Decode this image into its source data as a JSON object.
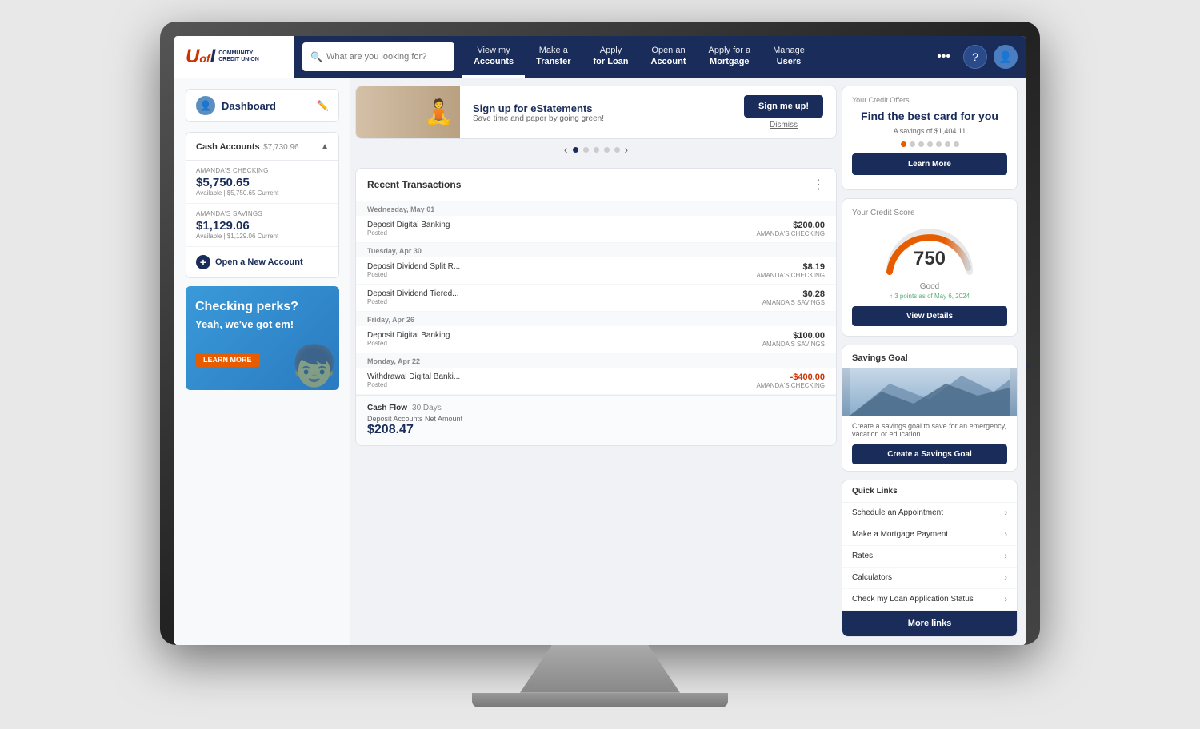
{
  "app": {
    "title": "U of I Community Credit Union",
    "logo_main": "UofI",
    "logo_sub_line1": "COMMUNITY",
    "logo_sub_line2": "CREDIT UNION"
  },
  "search": {
    "placeholder": "What are you looking for?"
  },
  "nav": {
    "items": [
      {
        "line1": "View my",
        "line2": "Accounts",
        "active": true
      },
      {
        "line1": "Make a",
        "line2": "Transfer",
        "active": false
      },
      {
        "line1": "Apply",
        "line2": "for Loan",
        "active": false
      },
      {
        "line1": "Open an",
        "line2": "Account",
        "active": false
      },
      {
        "line1": "Apply for a",
        "line2": "Mortgage",
        "active": false
      },
      {
        "line1": "Manage",
        "line2": "Users",
        "active": false
      }
    ],
    "more_label": "•••"
  },
  "sidebar": {
    "dashboard_title": "Dashboard",
    "cash_accounts_label": "Cash Accounts",
    "cash_accounts_total": "$7,730.96",
    "accounts": [
      {
        "name": "AMANDA'S CHECKING",
        "balance": "$5,750.65",
        "available": "Available | $5,750.65 Current"
      },
      {
        "name": "AMANDA'S SAVINGS",
        "balance": "$1,129.06",
        "available": "Available | $1,129.06 Current"
      }
    ],
    "open_account_label": "Open a New Account",
    "promo": {
      "title": "Checking perks?",
      "subtitle": "Yeah, we've got em!",
      "btn_label": "LEARN MORE"
    }
  },
  "banner": {
    "heading": "Sign up for eStatements",
    "subtext": "Save time and paper by going green!",
    "sign_up_btn": "Sign me up!",
    "dismiss_label": "Dismiss"
  },
  "transactions": {
    "title": "Recent Transactions",
    "groups": [
      {
        "date": "Wednesday, May 01",
        "items": [
          {
            "name": "Deposit Digital Banking",
            "sub": "Posted",
            "acct": "AMANDA'S CHECKING",
            "amount": "$200.00",
            "negative": false
          }
        ]
      },
      {
        "date": "Tuesday, Apr 30",
        "items": [
          {
            "name": "Deposit Dividend Split R...",
            "sub": "Posted",
            "acct": "AMANDA'S CHECKING",
            "amount": "$8.19",
            "negative": false
          },
          {
            "name": "Deposit Dividend Tiered...",
            "sub": "Posted",
            "acct": "AMANDA'S SAVINGS",
            "amount": "$0.28",
            "negative": false
          }
        ]
      },
      {
        "date": "Friday, Apr 26",
        "items": [
          {
            "name": "Deposit Digital Banking",
            "sub": "Posted",
            "acct": "AMANDA'S SAVINGS",
            "amount": "$100.00",
            "negative": false
          }
        ]
      },
      {
        "date": "Monday, Apr 22",
        "items": [
          {
            "name": "Withdrawal Digital Banki...",
            "sub": "Posted",
            "acct": "AMANDA'S CHECKING",
            "amount": "-$400.00",
            "negative": true
          }
        ]
      }
    ],
    "cash_flow_label": "Cash Flow",
    "cash_flow_period": "30 Days",
    "net_amount_label": "Deposit Accounts Net Amount",
    "net_amount_value": "$208.47"
  },
  "credit_score": {
    "label": "Your Credit Score",
    "score": "750",
    "rating": "Good",
    "points_note": "↑ 3 points as of May 6, 2024",
    "view_details_btn": "View Details"
  },
  "savings_goal": {
    "title": "Savings Goal",
    "description": "Create a savings goal to save for an emergency, vacation or education.",
    "create_btn": "Create a Savings Goal"
  },
  "credit_offers": {
    "label": "Your Credit Offers",
    "title": "Find the best card for you",
    "savings_text": "A savings of $1,404.11",
    "learn_more_btn": "Learn More"
  },
  "quick_links": {
    "title": "Quick Links",
    "items": [
      "Schedule an Appointment",
      "Make a Mortgage Payment",
      "Rates",
      "Calculators",
      "Check my Loan Application Status"
    ],
    "more_btn": "More links"
  }
}
